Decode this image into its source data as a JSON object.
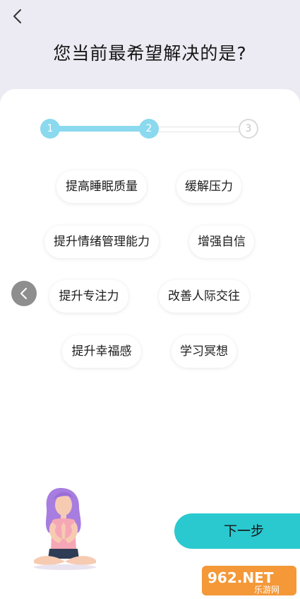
{
  "header": {
    "title": "您当前最希望解决的是?"
  },
  "stepper": {
    "steps": [
      "1",
      "2",
      "3"
    ],
    "current": 2
  },
  "options": [
    "提高睡眠质量",
    "缓解压力",
    "提升情绪管理能力",
    "增强自信",
    "提升专注力",
    "改善人际交往",
    "提升幸福感",
    "学习冥想"
  ],
  "footer": {
    "next_label": "下一步"
  },
  "watermark": {
    "text": "962.NET",
    "subtext": "乐游网"
  },
  "colors": {
    "accent": "#29c9cf",
    "step_active": "#8ad9ee",
    "background": "#ecebf3"
  }
}
